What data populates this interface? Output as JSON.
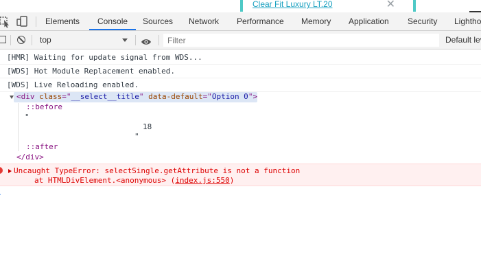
{
  "page": {
    "link_text": "Clear Fit Luxury LT.20",
    "close_glyph": "✕"
  },
  "tabs": [
    {
      "label": "Elements"
    },
    {
      "label": "Console"
    },
    {
      "label": "Sources"
    },
    {
      "label": "Network"
    },
    {
      "label": "Performance"
    },
    {
      "label": "Memory"
    },
    {
      "label": "Application"
    },
    {
      "label": "Security"
    },
    {
      "label": "Lighthouse"
    }
  ],
  "active_tab": "Console",
  "toolbar": {
    "context": "top",
    "filter_placeholder": "Filter",
    "levels": "Default levels"
  },
  "messages": [
    {
      "text": "[HMR] Waiting for update signal from WDS..."
    },
    {
      "text": "[WDS] Hot Module Replacement enabled."
    },
    {
      "text": "[WDS] Live Reloading enabled."
    }
  ],
  "element": {
    "tag_open": "<div",
    "attr1_name": "class",
    "attr1_value": "__select__title",
    "attr2_name": "data-default",
    "attr2_value": "Option 0",
    "tag_close_bracket": ">",
    "before": "::before",
    "quote_open": "\"",
    "number": "18",
    "quote_close": "\"",
    "after": "::after",
    "closing": "</div>"
  },
  "error": {
    "line1": "Uncaught TypeError: selectSingle.getAttribute is not a function",
    "line2_prefix": "at HTMLDivElement.<anonymous> (",
    "link": "index.js:550",
    "line2_suffix": ")"
  },
  "colors": {
    "accent": "#1a73e8",
    "error": "#d00000",
    "tag": "#881280",
    "attr_name": "#994500",
    "attr_value": "#1a1aa6"
  }
}
